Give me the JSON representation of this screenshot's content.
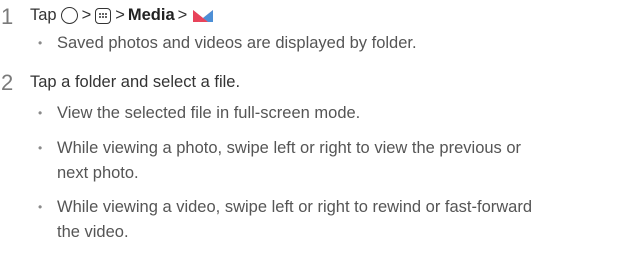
{
  "steps": [
    {
      "number": "1",
      "text_prefix": "Tap",
      "separator": ">",
      "bold_label": "Media",
      "icons": [
        "home-circle-icon",
        "apps-icon",
        "gallery-icon"
      ],
      "bullets": [
        "Saved photos and videos are displayed by folder."
      ]
    },
    {
      "number": "2",
      "text": "Tap a folder and select a file.",
      "bullets": [
        "View the selected file in full-screen mode.",
        "While viewing a photo, swipe left or right to view the previous or",
        "next photo.",
        "While viewing a video, swipe left or right to rewind or fast-forward",
        "the video."
      ]
    }
  ],
  "colors": {
    "gallery_red": "#e8435a",
    "gallery_pink": "#f08ca0",
    "gallery_blue": "#4d8fd6",
    "text": "#333333",
    "step_number": "#7a7a7a"
  }
}
